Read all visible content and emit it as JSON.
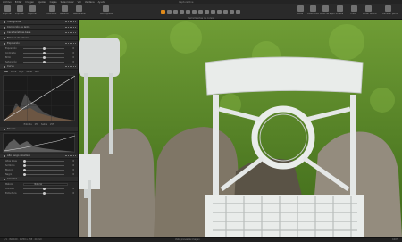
{
  "window_title": "Capture One",
  "menu": [
    "Archivo",
    "Editar",
    "Imagen",
    "Ajustes",
    "Capas",
    "Seleccionar",
    "Ver",
    "Ventana",
    "Ayuda"
  ],
  "toolbar_left": [
    "Importar",
    "Exportar",
    "Capturar",
    "Deshacer",
    "Rehacer",
    "Restablecer",
    "Auto ajustar"
  ],
  "toolbar_right": [
    "Grilla",
    "Cuadrícula",
    "Aviso de expo.",
    "Prueba",
    "Editar",
    "Editar lateral",
    "Cambiar perfil"
  ],
  "tools_label": "Herramientas de cursor",
  "panel": {
    "sections": [
      {
        "label": "Histograma"
      },
      {
        "label": "Corrección de lente"
      },
      {
        "label": "Características base"
      },
      {
        "label": "Balance de blancos"
      },
      {
        "label": "Exposición",
        "rows": [
          {
            "label": "Exposición",
            "value": "0"
          },
          {
            "label": "Contraste",
            "value": "0"
          },
          {
            "label": "Brillo",
            "value": "0"
          },
          {
            "label": "Saturación",
            "value": "0"
          }
        ]
      },
      {
        "label": "Curva",
        "tabs": [
          "RGB",
          "Luma",
          "Rojo",
          "Verde",
          "Azul"
        ],
        "footer": [
          "Entrada",
          "255",
          "Salida",
          "255"
        ]
      },
      {
        "label": "Niveles"
      },
      {
        "label": "Alto rango dinámico",
        "rows": [
          {
            "label": "Altas luces",
            "value": "0"
          },
          {
            "label": "Sombras",
            "value": "0"
          },
          {
            "label": "Blanco",
            "value": "0"
          },
          {
            "label": "Negro",
            "value": "0"
          }
        ]
      },
      {
        "label": "Claridad",
        "rows": [
          {
            "label": "Método",
            "value": "Natural"
          },
          {
            "label": "Claridad",
            "value": "0"
          },
          {
            "label": "Estructura",
            "value": "0"
          }
        ]
      }
    ]
  },
  "status": {
    "left": "1/1 · ISO 100 · 1/250 s · f/8 · 24 mm",
    "center": "Vista previa de imagen",
    "right": "100%"
  },
  "colors": {
    "accent": "#e08a1a",
    "grass": "#5f8f2a",
    "chair": "#e9ecea"
  }
}
